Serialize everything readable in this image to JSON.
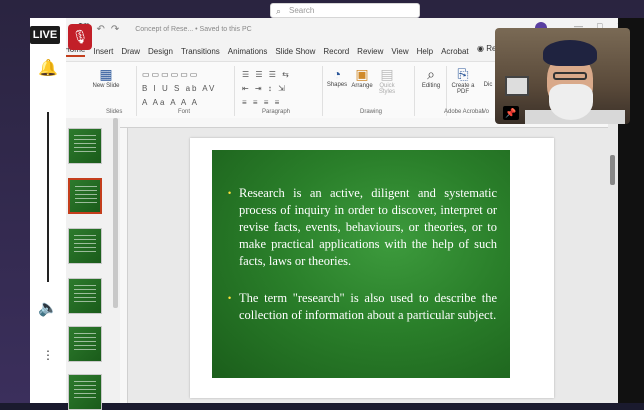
{
  "stream": {
    "live_label": "LIVE"
  },
  "titlebar": {
    "doc_title": "Concept of Rese... • Saved to this PC",
    "search_placeholder": "Search",
    "controls": [
      "—",
      "□",
      "✕"
    ]
  },
  "tabs": [
    "Home",
    "Insert",
    "Draw",
    "Design",
    "Transitions",
    "Animations",
    "Slide Show",
    "Record",
    "Review",
    "View",
    "Help",
    "Acrobat"
  ],
  "ribbon": {
    "new_slide": "New Slide",
    "shapes": "Shapes",
    "arrange": "Arrange",
    "quick_styles": "Quick Styles",
    "editing": "Editing",
    "create_pdf": "Create a PDF",
    "dictate_partial": "Dic",
    "groups": {
      "slides": "Slides",
      "font": "Font",
      "paragraph": "Paragraph",
      "drawing": "Drawing",
      "adobe": "Adobe Acrobat",
      "voice_partial": "Vo"
    },
    "present_partial": "Re"
  },
  "slide": {
    "bullet1": "Research is an active, diligent and systematic process of inquiry in order to discover, interpret or revise facts, events, behaviours, or theories, or to make practical applications with the help of such facts, laws or theories.",
    "bullet2": "The term \"research\" is also used to describe the collection of information about a particular subject."
  },
  "colors": {
    "accent": "#c43e1c",
    "slide_green": "#2a7f2a",
    "bullet_yellow": "#ffe03a",
    "mic_red": "#c21f28"
  },
  "icons": [
    "bell-icon",
    "speaker-icon",
    "more-icon",
    "mic-off-icon",
    "pin-icon",
    "search-icon"
  ]
}
